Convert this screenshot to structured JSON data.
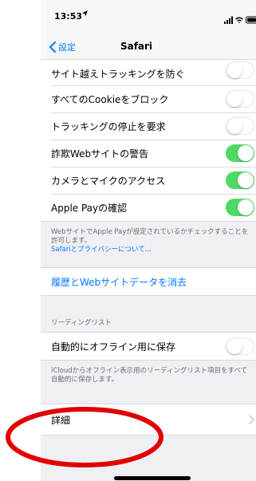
{
  "status_bar": {
    "time": "13:53",
    "location_icon": "location-arrow-icon",
    "signal_icon": "signal-bars-icon",
    "wifi_icon": "wifi-icon",
    "battery_icon": "battery-icon"
  },
  "nav": {
    "back_label": "設定",
    "title": "Safari"
  },
  "privacy_rows": [
    {
      "label": "サイト越えトラッキングを防ぐ",
      "toggle": "off"
    },
    {
      "label": "すべてのCookieをブロック",
      "toggle": "off"
    },
    {
      "label": "トラッキングの停止を要求",
      "toggle": "off"
    },
    {
      "label": "詐欺Webサイトの警告",
      "toggle": "on"
    },
    {
      "label": "カメラとマイクのアクセス",
      "toggle": "on"
    },
    {
      "label": "Apple Payの確認",
      "toggle": "on"
    }
  ],
  "apple_pay_footnote": {
    "text": "WebサイトでApple Payが設定されているかチェックすることを許可します。",
    "link": "Safariとプライバシーについて..."
  },
  "clear_history_label": "履歴とWebサイトデータを消去",
  "reading_list": {
    "header": "リーディングリスト",
    "auto_save_label": "自動的にオフライン用に保存",
    "auto_save_toggle": "off",
    "footnote": "iCloudからオフライン表示用のリーディングリスト項目をすべて自動的に保存します。"
  },
  "advanced_label": "詳細",
  "colors": {
    "accent": "#007aff",
    "toggle_on": "#4cd964",
    "annotation": "#e10000"
  }
}
